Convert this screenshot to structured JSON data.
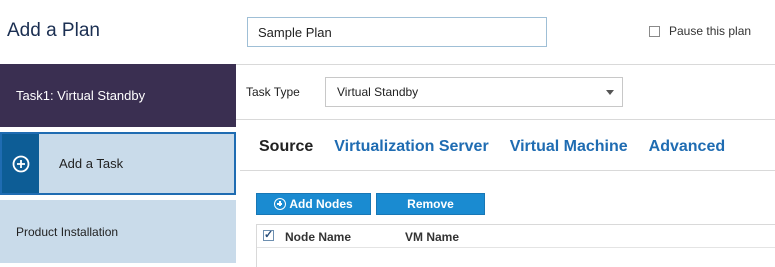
{
  "header": {
    "title": "Add a Plan",
    "plan_name_value": "Sample Plan",
    "pause_label": "Pause this plan"
  },
  "sidebar": {
    "items": [
      {
        "label": "Task1: Virtual Standby"
      },
      {
        "label": "Add a Task",
        "icon": "plus-circle-icon"
      },
      {
        "label": "Product Installation"
      }
    ]
  },
  "task_type": {
    "label": "Task Type",
    "selected": "Virtual Standby"
  },
  "tabs": [
    {
      "label": "Source"
    },
    {
      "label": "Virtualization Server"
    },
    {
      "label": "Virtual Machine"
    },
    {
      "label": "Advanced"
    }
  ],
  "toolbar": {
    "add_nodes_label": "Add Nodes",
    "remove_label": "Remove"
  },
  "table": {
    "columns": [
      "Node Name",
      "VM Name"
    ]
  },
  "colors": {
    "accent": "#1f6cb2",
    "button": "#1a8bd1",
    "task_dark": "#3a2f51",
    "sidebar_light": "#c9dbea"
  }
}
